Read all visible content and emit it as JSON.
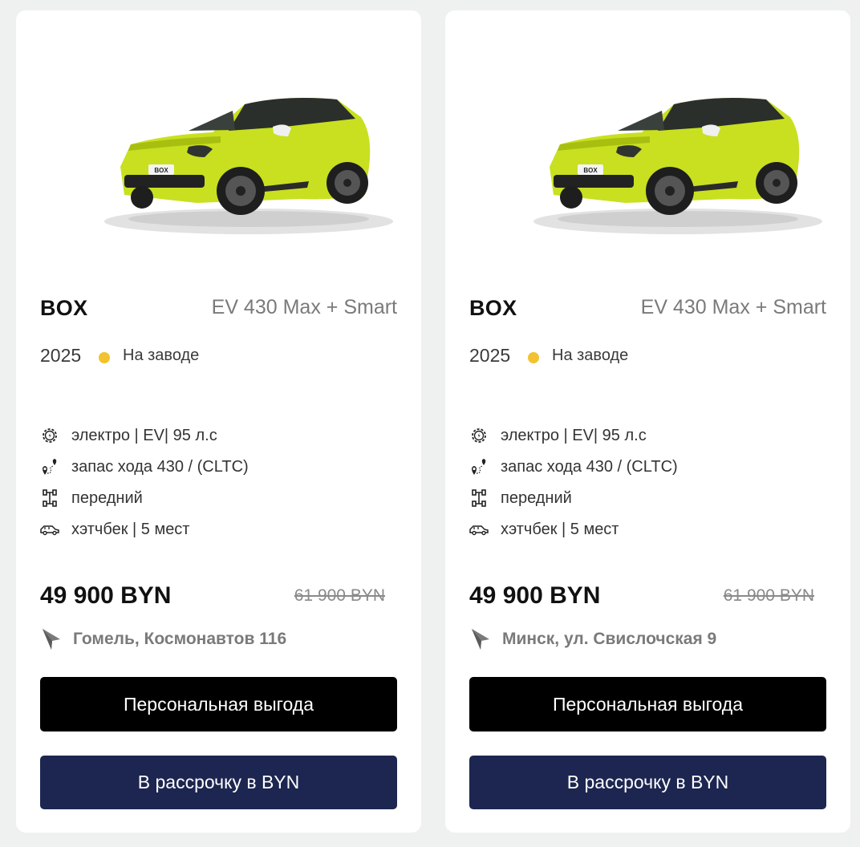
{
  "colors": {
    "page_bg": "#eef1f0",
    "card_bg": "#ffffff",
    "status_dot": "#f2c230",
    "primary_button": "#000000",
    "secondary_button": "#1c2650"
  },
  "cards": [
    {
      "car_badge": "BOX",
      "brand": "BOX",
      "trim": "EV 430 Max + Smart",
      "year": "2025",
      "status": "На заводе",
      "specs": [
        {
          "icon": "engine-gear-icon",
          "text": "электро | EV| 95 л.с"
        },
        {
          "icon": "route-icon",
          "text": "запас хода 430 / (CLTC)"
        },
        {
          "icon": "drivetrain-icon",
          "text": "передний"
        },
        {
          "icon": "car-body-icon",
          "text": "хэтчбек | 5 мест"
        }
      ],
      "price": "49 900 BYN",
      "old_price": "61 900 BYN",
      "location_icon": "location-arrow-icon",
      "location": "Гомель, Космонавтов 116",
      "primary_button": "Персональная выгода",
      "secondary_button": "В рассрочку в BYN"
    },
    {
      "car_badge": "BOX",
      "brand": "BOX",
      "trim": "EV 430 Max + Smart",
      "year": "2025",
      "status": "На заводе",
      "specs": [
        {
          "icon": "engine-gear-icon",
          "text": "электро | EV| 95 л.с"
        },
        {
          "icon": "route-icon",
          "text": "запас хода 430 / (CLTC)"
        },
        {
          "icon": "drivetrain-icon",
          "text": "передний"
        },
        {
          "icon": "car-body-icon",
          "text": "хэтчбек | 5 мест"
        }
      ],
      "price": "49 900 BYN",
      "old_price": "61 900 BYN",
      "location_icon": "location-arrow-icon",
      "location": "Минск, ул. Свислочская 9",
      "primary_button": "Персональная выгода",
      "secondary_button": "В рассрочку в BYN"
    }
  ]
}
